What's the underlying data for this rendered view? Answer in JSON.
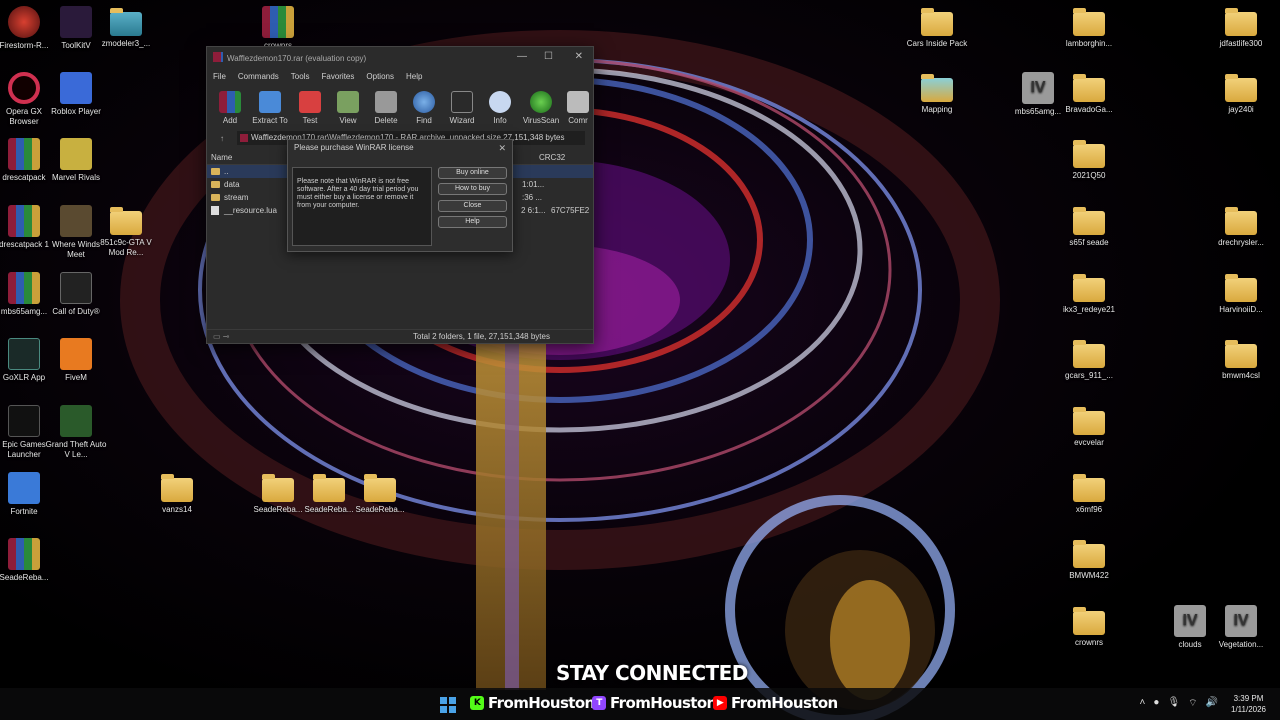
{
  "desktop_icons_left": [
    {
      "label": "Firestorm-R...",
      "type": "app"
    },
    {
      "label": "ToolKitV",
      "type": "app"
    },
    {
      "label": "zmodeler3_...",
      "type": "app"
    },
    {
      "label": "crownrs",
      "type": "rar"
    },
    {
      "label": "Opera GX Browser",
      "type": "app"
    },
    {
      "label": "Roblox Player",
      "type": "app"
    },
    {
      "label": "drescatpack",
      "type": "rar"
    },
    {
      "label": "Marvel Rivals",
      "type": "app"
    },
    {
      "label": "drescatpack 1",
      "type": "rar"
    },
    {
      "label": "Where Winds Meet",
      "type": "app"
    },
    {
      "label": "851c9c-GTA V Mod Re...",
      "type": "folder"
    },
    {
      "label": "mbs65amg...",
      "type": "rar"
    },
    {
      "label": "Call of Duty®",
      "type": "app"
    },
    {
      "label": "GoXLR App",
      "type": "app"
    },
    {
      "label": "FiveM",
      "type": "app"
    },
    {
      "label": "Epic Games Launcher",
      "type": "app"
    },
    {
      "label": "Grand Theft Auto V Le...",
      "type": "app"
    },
    {
      "label": "Fortnite",
      "type": "app"
    },
    {
      "label": "vanzs14",
      "type": "folder"
    },
    {
      "label": "SeadeReba...",
      "type": "folder"
    },
    {
      "label": "SeadeReba...",
      "type": "folder"
    },
    {
      "label": "SeadeReba...",
      "type": "folder"
    },
    {
      "label": "SeadeReba...",
      "type": "rar"
    }
  ],
  "desktop_icons_right": [
    {
      "label": "Cars Inside Pack",
      "type": "folder"
    },
    {
      "label": "lamborghin...",
      "type": "folder"
    },
    {
      "label": "jdfastlife300",
      "type": "folder"
    },
    {
      "label": "Mapping",
      "type": "folder"
    },
    {
      "label": "mbs65amg...",
      "type": "iv"
    },
    {
      "label": "BravadoGa...",
      "type": "folder"
    },
    {
      "label": "jay240i",
      "type": "folder"
    },
    {
      "label": "2021Q50",
      "type": "folder"
    },
    {
      "label": "s65f seade",
      "type": "folder"
    },
    {
      "label": "drechrysler...",
      "type": "folder"
    },
    {
      "label": "ikx3_redeye21",
      "type": "folder"
    },
    {
      "label": "HarvinoiiD...",
      "type": "folder"
    },
    {
      "label": "gcars_911_...",
      "type": "folder"
    },
    {
      "label": "bmwm4csl",
      "type": "folder"
    },
    {
      "label": "evcvelar",
      "type": "folder"
    },
    {
      "label": "x6mf96",
      "type": "folder"
    },
    {
      "label": "BMWM422",
      "type": "folder"
    },
    {
      "label": "crownrs",
      "type": "folder"
    },
    {
      "label": "clouds",
      "type": "iv"
    },
    {
      "label": "Vegetation...",
      "type": "iv"
    }
  ],
  "winrar": {
    "title": "Wafflezdemon170.rar (evaluation copy)",
    "menu": [
      "File",
      "Commands",
      "Tools",
      "Favorites",
      "Options",
      "Help"
    ],
    "toolbar": [
      "Add",
      "Extract To",
      "Test",
      "View",
      "Delete",
      "Find",
      "Wizard",
      "Info",
      "VirusScan",
      "Comr"
    ],
    "path": "Wafflezdemon170.rar\\Wafflezdemon170 - RAR archive, unpacked size 27,151,348 bytes",
    "columns": {
      "name": "Name",
      "crc": "CRC32"
    },
    "rows": [
      {
        "name": "..",
        "partial": "",
        "crc": ""
      },
      {
        "name": "data",
        "partial": "1:01...",
        "crc": ""
      },
      {
        "name": "stream",
        "partial": ":36 ...",
        "crc": ""
      },
      {
        "name": "__resource.lua",
        "partial": "2 6:1...",
        "crc": "67C75FE2"
      }
    ],
    "status": "Total 2 folders, 1 file, 27,151,348 bytes"
  },
  "license_dialog": {
    "title": "Please purchase WinRAR license",
    "message": "Please note that WinRAR is not free software. After a 40 day trial period you must either buy a license or remove it from your computer.",
    "buttons": [
      "Buy online",
      "How to buy",
      "Close",
      "Help"
    ]
  },
  "caption": "STAY CONNECTED",
  "taskbar": {
    "socials": [
      {
        "platform": "kick",
        "handle": "FromHouston",
        "color": "#53fc18"
      },
      {
        "platform": "twitch",
        "handle": "FromHouston",
        "color": "#9146ff"
      },
      {
        "platform": "youtube",
        "handle": "FromHouston",
        "color": "#ff0000"
      }
    ],
    "time": "3:39 PM",
    "date": "1/11/2026"
  }
}
